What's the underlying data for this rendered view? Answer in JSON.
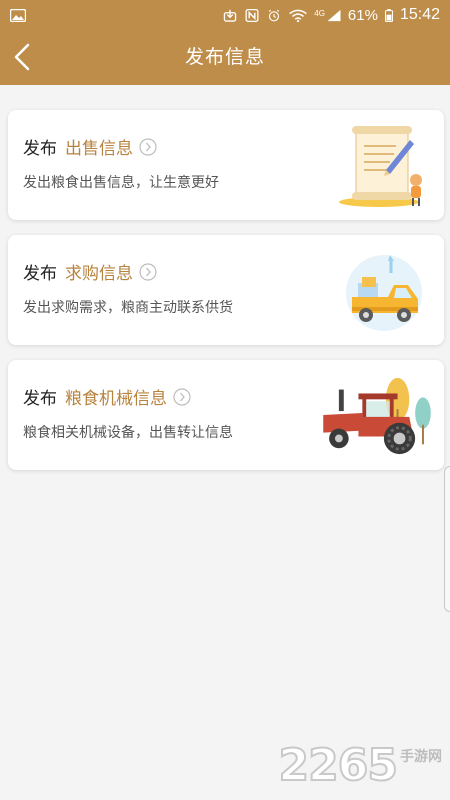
{
  "status_bar": {
    "signal_label": "4G",
    "battery_percent": "61%",
    "time": "15:42",
    "icons": [
      "image-icon",
      "download-icon",
      "nfc-icon",
      "alarm-icon",
      "wifi-icon",
      "signal-icon",
      "battery-icon"
    ]
  },
  "navbar": {
    "back_icon": "chevron-left-icon",
    "title": "发布信息"
  },
  "cards": [
    {
      "prefix": "发布",
      "kind": "出售信息",
      "desc": "发出粮食出售信息，让生意更好",
      "illustration": "scroll-pencil-illustration"
    },
    {
      "prefix": "发布",
      "kind": "求购信息",
      "desc": "发出求购需求，粮商主动联系供货",
      "illustration": "delivery-truck-illustration"
    },
    {
      "prefix": "发布",
      "kind": "粮食机械信息",
      "desc": "粮食相关机械设备，出售转让信息",
      "illustration": "tractor-illustration"
    }
  ],
  "colors": {
    "brand": "#bf8d4a",
    "accent_text": "#b8833f",
    "background": "#f4f4f4"
  },
  "watermark": {
    "number": "2265",
    "text": "手游网"
  }
}
